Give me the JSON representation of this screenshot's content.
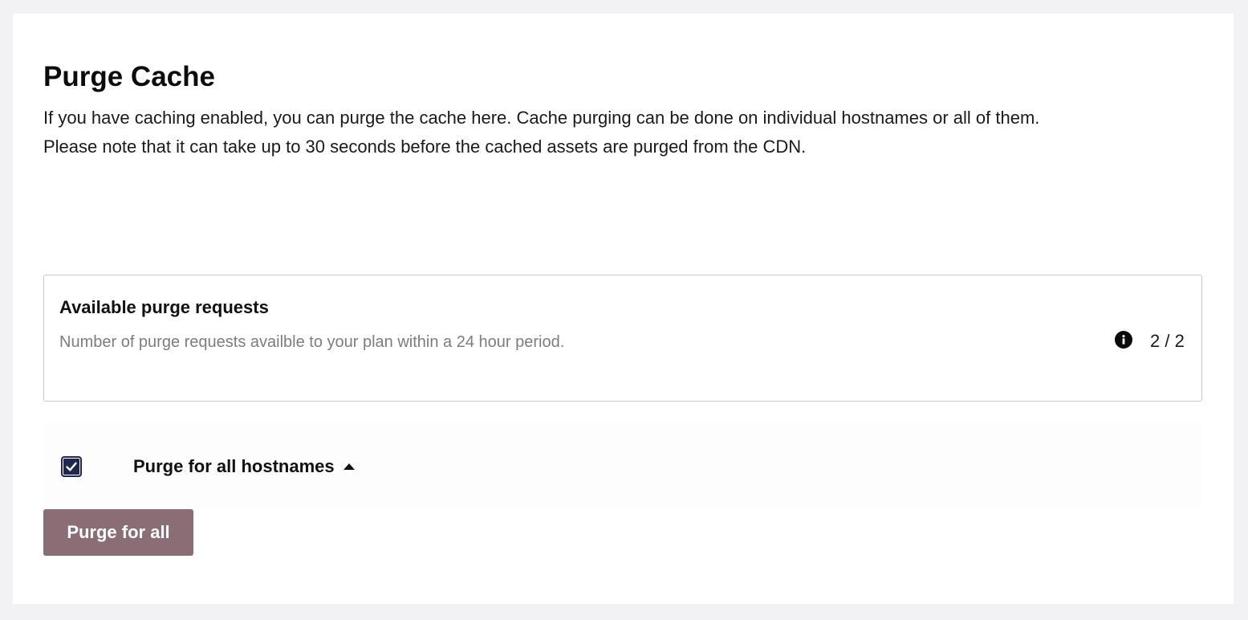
{
  "header": {
    "title": "Purge Cache",
    "description_line1": "If you have caching enabled, you can purge the cache here. Cache purging can be done on individual hostnames or all of them.",
    "description_line2": "Please note that it can take up to 30 seconds before the cached assets are purged from the CDN."
  },
  "quota": {
    "title": "Available purge requests",
    "description": "Number of purge requests availble to your plan within a 24 hour period.",
    "value": "2 / 2",
    "info_icon": "info-icon"
  },
  "hostnames": {
    "checkbox_checked": true,
    "label": "Purge for all hostnames",
    "toggle_icon": "caret-up-icon"
  },
  "actions": {
    "purge_label": "Purge for all"
  },
  "colors": {
    "checkbox": "#1f2650",
    "purge_button": "#8a6e76",
    "page_background": "#f2f2f4"
  }
}
